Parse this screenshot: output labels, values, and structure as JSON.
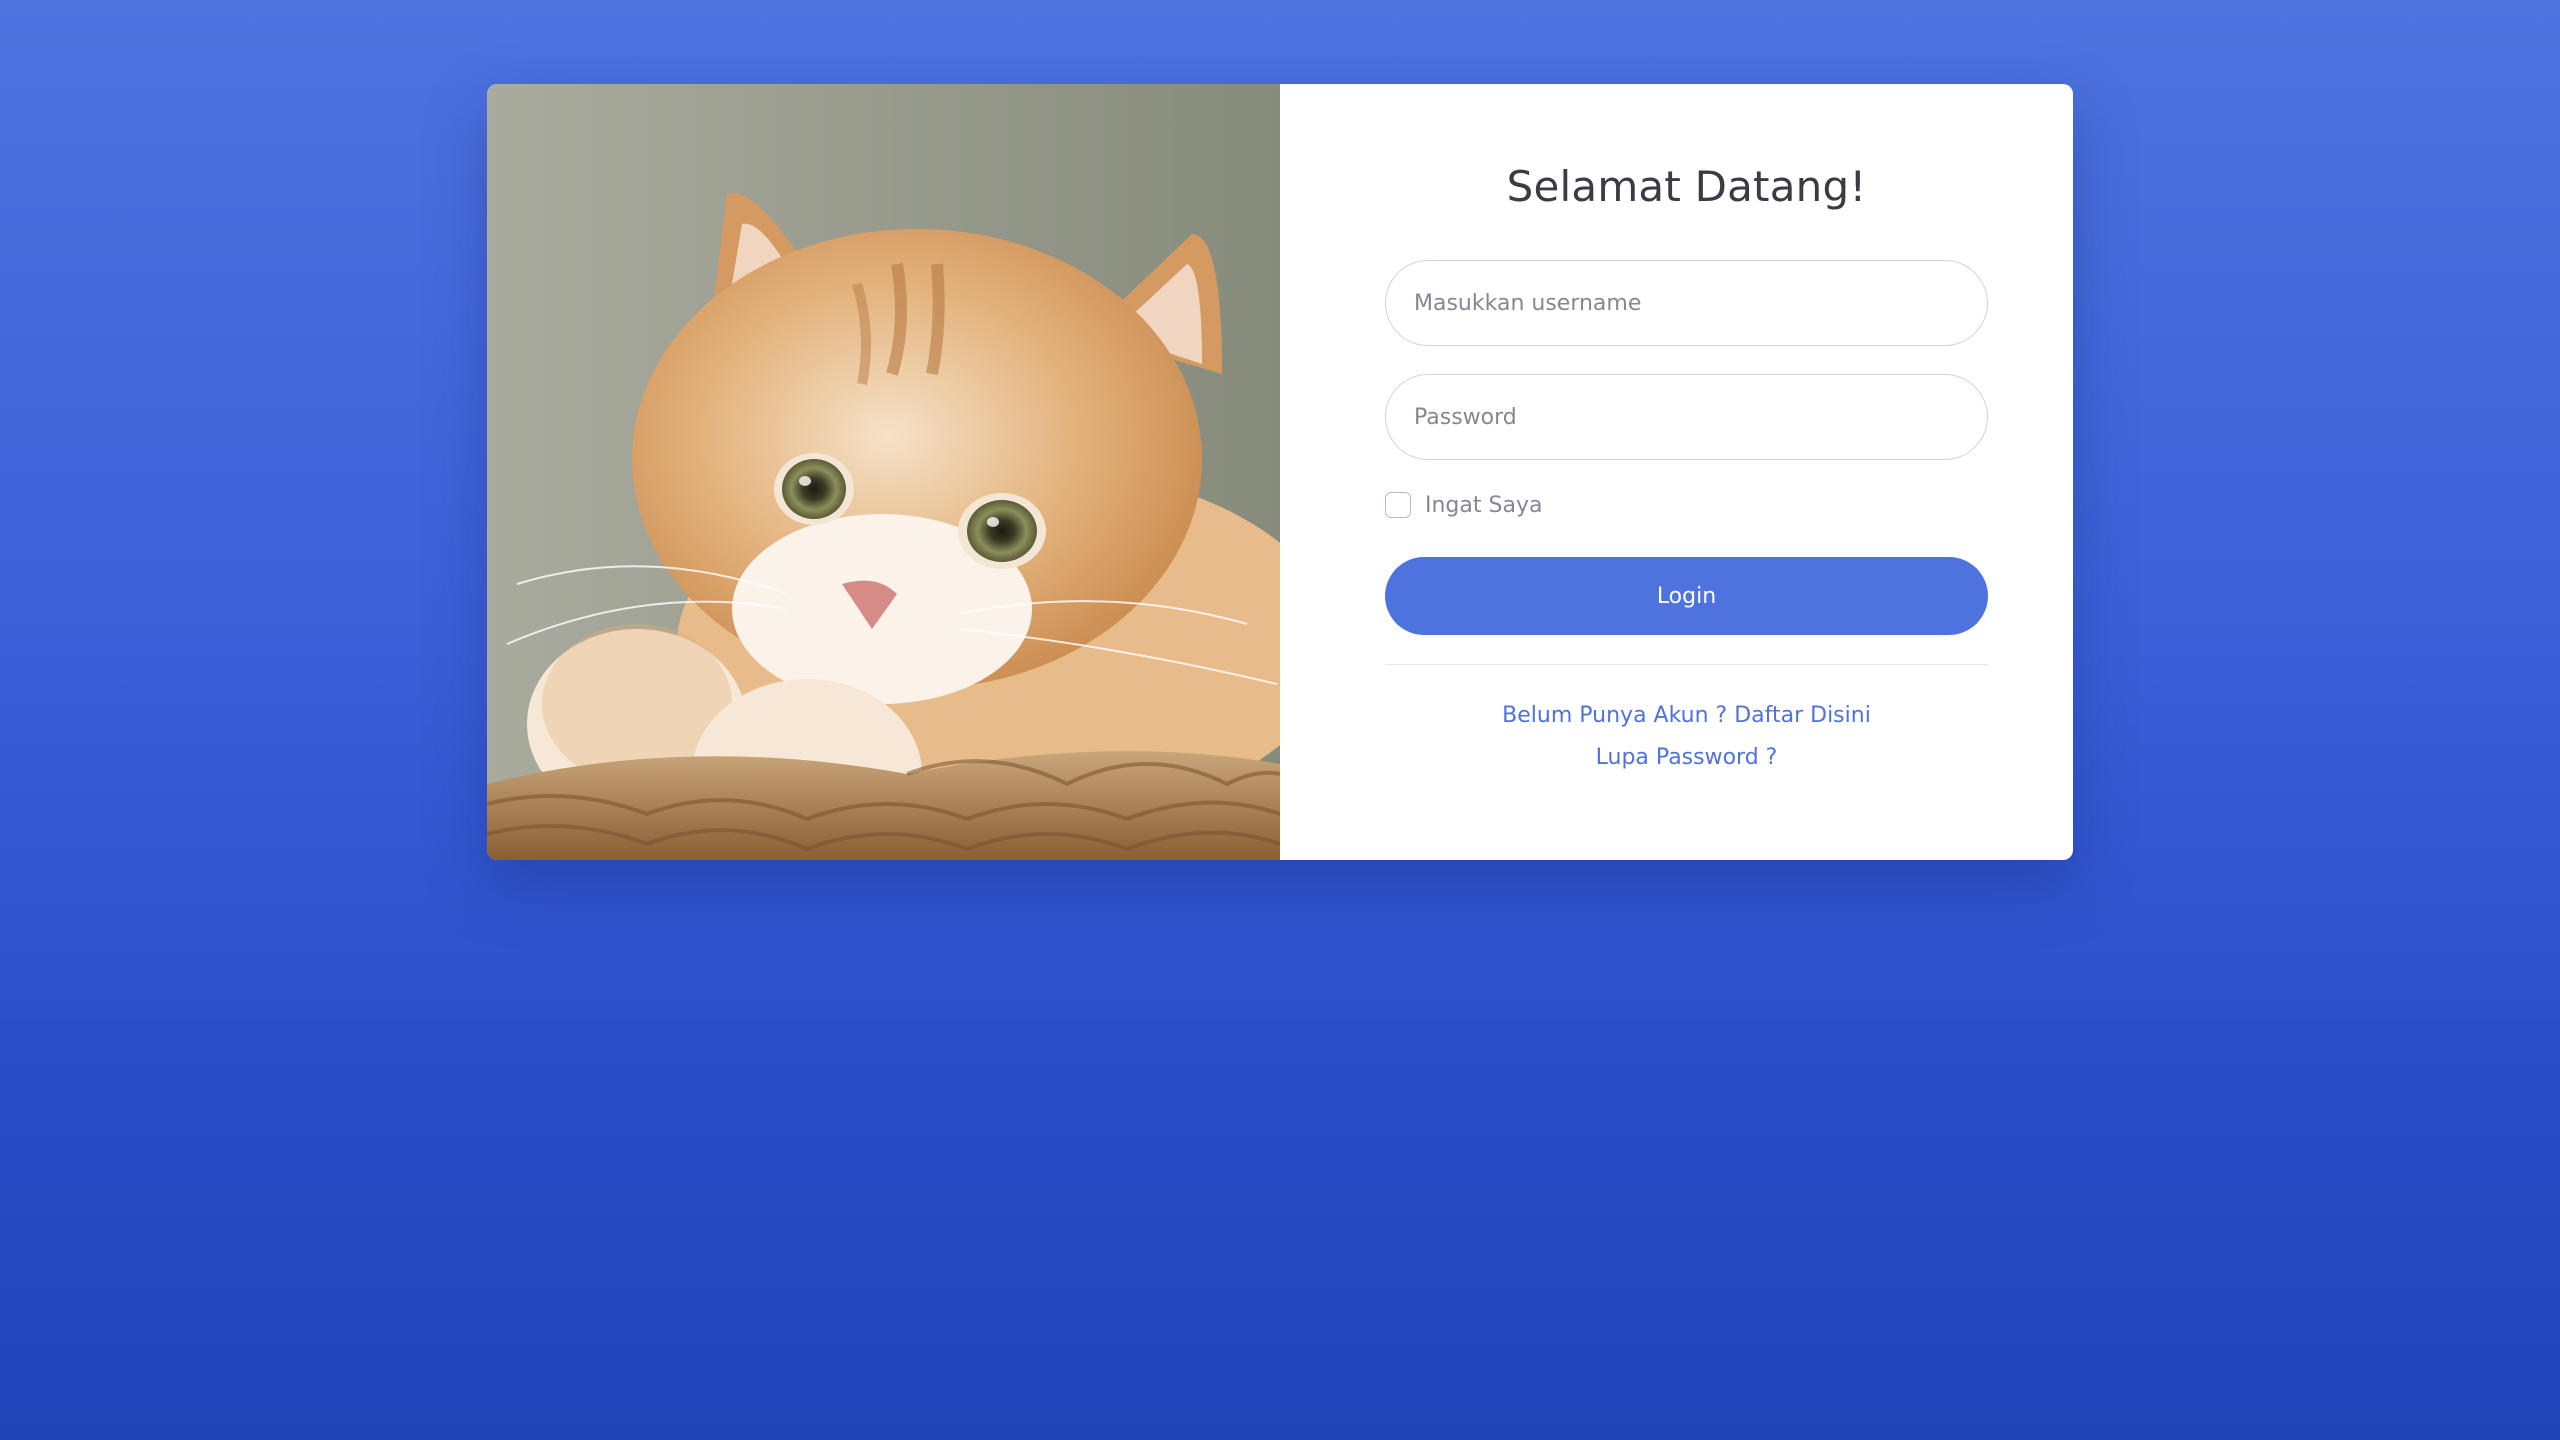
{
  "login_card": {
    "image": {
      "description_icon": "cat-photo",
      "alt": ""
    },
    "title": "Selamat Datang!",
    "username": {
      "placeholder": "Masukkan username",
      "value": ""
    },
    "password": {
      "placeholder": "Password",
      "value": ""
    },
    "remember": {
      "label": "Ingat Saya",
      "checked": false
    },
    "login_label": "Login",
    "register_link": "Belum Punya Akun ? Daftar Disini",
    "forgot_link": "Lupa Password ?"
  },
  "colors": {
    "primary": "#4e73df",
    "background_top": "#4e73df",
    "background_bottom": "#2143b8",
    "text_dark": "#3a3b45",
    "text_muted": "#858796",
    "border": "#d1d3e2"
  }
}
